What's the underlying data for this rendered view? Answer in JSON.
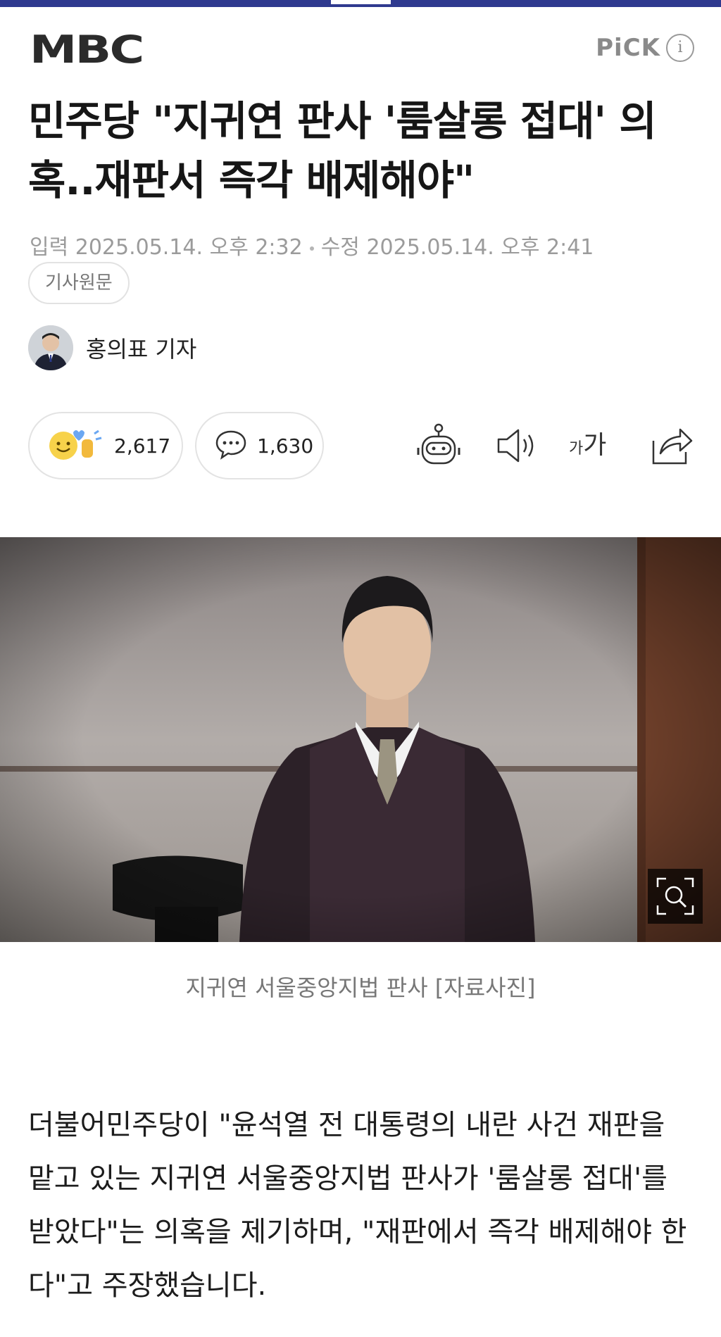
{
  "header": {
    "logo": "MBC",
    "pick_label": "PiCK",
    "pick_info": "i"
  },
  "article": {
    "headline": "민주당 \"지귀연 판사 '룸살롱 접대' 의혹..재판서 즉각 배제해야\"",
    "published_label": "입력",
    "published": "2025.05.14. 오후 2:32",
    "modified_label": "수정",
    "modified": "2025.05.14. 오후 2:41",
    "original_button": "기사원문",
    "reporter": "홍의표 기자",
    "reaction_count": "2,617",
    "comment_count": "1,630",
    "tool_font_label": "가가",
    "photo_caption": "지귀연 서울중앙지법 판사 [자료사진]",
    "body": "더불어민주당이 \"윤석열 전 대통령의 내란 사건 재판을 맡고 있는 지귀연 서울중앙지법 판사가 '룸살롱 접대'를 받았다\"는 의혹을 제기하며, \"재판에서 즉각 배제해야 한다\"고 주장했습니다."
  },
  "colors": {
    "top_bar": "#2f3a8f",
    "meta_text": "#9b9b9b"
  },
  "icons": [
    "emoji-reaction-icon",
    "comment-icon",
    "robot-summary-icon",
    "speaker-icon",
    "font-size-icon",
    "share-icon",
    "zoom-icon"
  ]
}
